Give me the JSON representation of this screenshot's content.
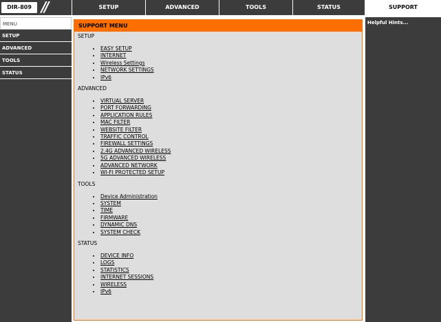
{
  "header": {
    "model": "DIR-809",
    "tabs": [
      {
        "label": "SETUP",
        "width": 107
      },
      {
        "label": "ADVANCED",
        "width": 107
      },
      {
        "label": "TOOLS",
        "width": 107
      },
      {
        "label": "STATUS",
        "width": 105
      },
      {
        "label": "SUPPORT",
        "width": 111
      }
    ]
  },
  "sidebar": {
    "items": [
      {
        "label": "MENU"
      },
      {
        "label": "SETUP"
      },
      {
        "label": "ADVANCED"
      },
      {
        "label": "TOOLS"
      },
      {
        "label": "STATUS"
      }
    ]
  },
  "main": {
    "title": "SUPPORT MENU",
    "sections": [
      {
        "title": "SETUP",
        "links": [
          "EASY SETUP",
          "INTERNET",
          "Wireless Settings",
          "NETWORK SETTINGS",
          "IPv6"
        ]
      },
      {
        "title": "ADVANCED",
        "links": [
          "VIRTUAL SERVER",
          "PORT FORWARDING",
          "APPLICATION RULES",
          "MAC FILTER",
          "WEBSITE FILTER",
          "TRAFFIC CONTROL",
          "FIREWALL SETTINGS",
          "2.4G ADVANCED WIRELESS",
          "5G ADVANCED WIRELESS",
          "ADVANCED NETWORK",
          "WI-FI PROTECTED SETUP"
        ]
      },
      {
        "title": "TOOLS",
        "links": [
          "Device Administration",
          "SYSTEM",
          "TIME",
          "FIRMWARE",
          "DYNAMIC DNS",
          "SYSTEM CHECK"
        ]
      },
      {
        "title": "STATUS",
        "links": [
          "DEVICE INFO",
          "LOGS",
          "STATISTICS",
          "INTERNET SESSIONS",
          "WIRELESS",
          "IPv6"
        ]
      }
    ]
  },
  "hints": {
    "title": "Helpful Hints..."
  }
}
